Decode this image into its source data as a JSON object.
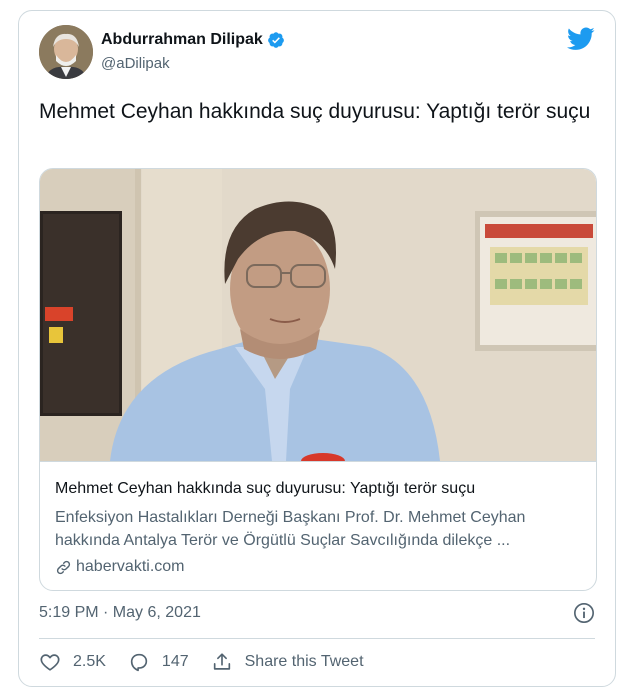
{
  "author": {
    "name": "Abdurrahman Dilipak",
    "handle": "@aDilipak"
  },
  "tweet": {
    "text": "Mehmet Ceyhan hakkında suç duyurusu: Yaptığı terör suçu",
    "timestamp": "5:19 PM · May 6, 2021"
  },
  "link_card": {
    "title": "Mehmet Ceyhan hakkında suç duyurusu: Yaptığı terör suçu",
    "description": "Enfeksiyon Hastalıkları Derneği Başkanı Prof. Dr. Mehmet Ceyhan hakkında Antalya Terör ve Örgütlü Suçlar Savcılığında dilekçe ...",
    "domain": "habervakti.com"
  },
  "actions": {
    "likes": "2.5K",
    "replies": "147",
    "share_label": "Share this Tweet"
  },
  "colors": {
    "brand_blue": "#1d9bf0",
    "text_primary": "#0f1419",
    "text_secondary": "#536471",
    "border": "#cfd9de"
  },
  "icons": [
    "verified-badge-icon",
    "twitter-bird-icon",
    "link-icon",
    "info-icon",
    "heart-icon",
    "reply-icon",
    "share-icon"
  ]
}
